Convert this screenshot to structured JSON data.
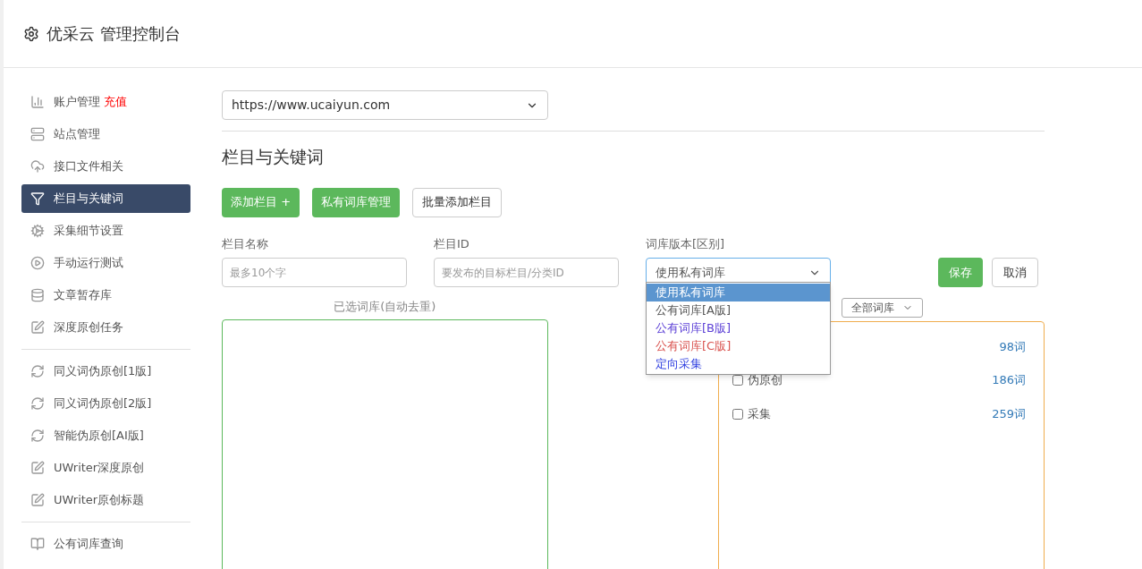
{
  "header": {
    "title": "优采云 管理控制台"
  },
  "sidebar": {
    "groups": [
      {
        "items": [
          {
            "label": "账户管理",
            "badge": "充值",
            "selected": false
          },
          {
            "label": "站点管理",
            "selected": false
          },
          {
            "label": "接口文件相关",
            "selected": false
          },
          {
            "label": "栏目与关键词",
            "selected": true
          },
          {
            "label": "采集细节设置",
            "selected": false
          },
          {
            "label": "手动运行测试",
            "selected": false
          },
          {
            "label": "文章暂存库",
            "selected": false
          },
          {
            "label": "深度原创任务",
            "selected": false
          }
        ]
      },
      {
        "items": [
          {
            "label": "同义词伪原创[1版]",
            "selected": false
          },
          {
            "label": "同义词伪原创[2版]",
            "selected": false
          },
          {
            "label": "智能伪原创[AI版]",
            "selected": false
          },
          {
            "label": "UWriter深度原创",
            "selected": false
          },
          {
            "label": "UWriter原创标题",
            "selected": false
          }
        ]
      },
      {
        "items": [
          {
            "label": "公有词库查询",
            "selected": false
          }
        ]
      }
    ]
  },
  "site_select": {
    "value": "https://www.ucaiyun.com"
  },
  "section_title": "栏目与关键词",
  "buttons": [
    {
      "label": "添加栏目 +",
      "kind": "primary"
    },
    {
      "label": "私有词库管理",
      "kind": "primary"
    },
    {
      "label": "批量添加栏目",
      "kind": "outline"
    }
  ],
  "form": {
    "fields": [
      {
        "label": "栏目名称",
        "placeholder": "最多10个字"
      },
      {
        "label": "栏目ID",
        "placeholder": "要发布的目标栏目/分类ID"
      }
    ],
    "library_select": {
      "label": "词库版本[区别]",
      "value": "使用私有词库",
      "expanded": true,
      "options": [
        {
          "label": "使用私有词库",
          "selected": true
        },
        {
          "label": "公有词库[A版]",
          "selected": false,
          "color": "#555555"
        },
        {
          "label": "公有词库[B版]",
          "selected": false,
          "color": "#5b3fd6"
        },
        {
          "label": "公有词库[C版]",
          "selected": false,
          "color": "#d9534f"
        },
        {
          "label": "定向采集",
          "selected": false,
          "color": "#2f3fe0"
        }
      ]
    },
    "save": "保存",
    "cancel": "取消"
  },
  "selected_panel": {
    "label": "已选词库(自动去重)"
  },
  "library_panel": {
    "filter": "全部词库",
    "rows": [
      {
        "count": "98词"
      },
      {
        "label": "伪原创",
        "count": "186词",
        "checked": false
      },
      {
        "label": "采集",
        "count": "259词",
        "checked": false
      }
    ]
  }
}
